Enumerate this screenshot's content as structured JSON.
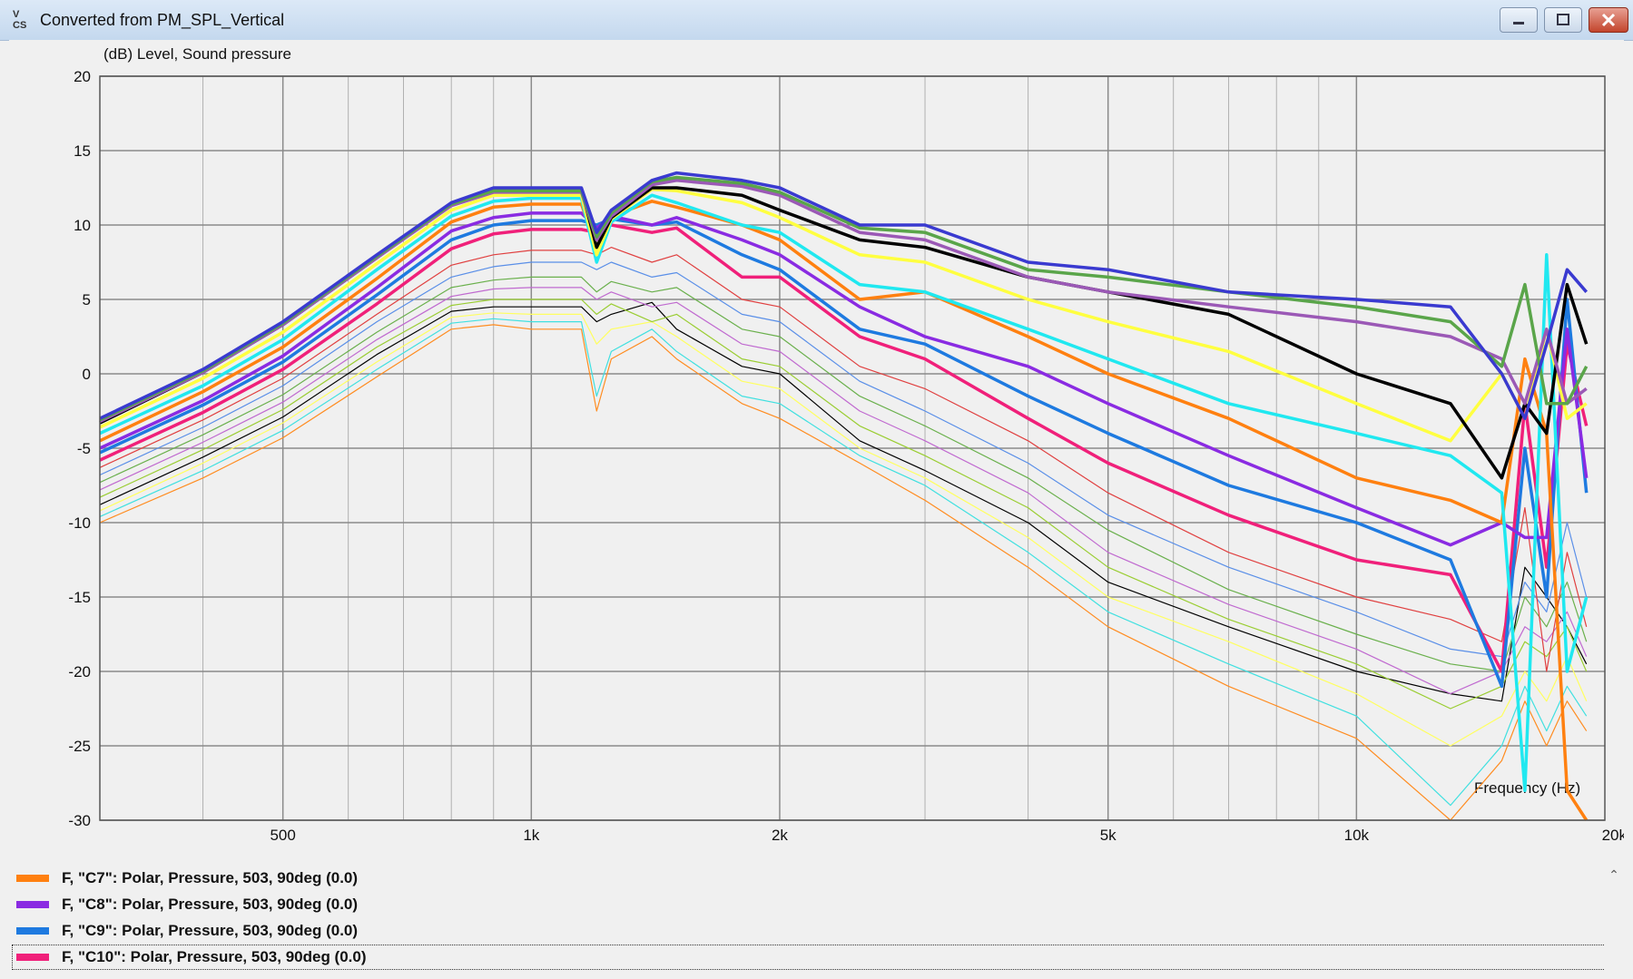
{
  "window": {
    "title": "Converted from PM_SPL_Vertical",
    "icon_name": "app-logo-icon",
    "icon_text": [
      "V",
      "CS"
    ]
  },
  "chart_data": {
    "type": "line",
    "title": "",
    "ylabel": "(dB)  Level, Sound pressure",
    "xlabel": "Frequency  (Hz)",
    "xscale": "log",
    "xlim": [
      300,
      20000
    ],
    "ylim": [
      -30,
      20
    ],
    "grid": true,
    "x_tick_labels": [
      {
        "v": 500,
        "t": "500"
      },
      {
        "v": 1000,
        "t": "1k"
      },
      {
        "v": 2000,
        "t": "2k"
      },
      {
        "v": 5000,
        "t": "5k"
      },
      {
        "v": 10000,
        "t": "10k"
      },
      {
        "v": 20000,
        "t": "20k"
      }
    ],
    "y_ticks": [
      20,
      15,
      10,
      5,
      0,
      -5,
      -10,
      -15,
      -20,
      -25,
      -30
    ],
    "x": [
      300,
      400,
      500,
      650,
      800,
      900,
      1000,
      1150,
      1200,
      1250,
      1400,
      1500,
      1800,
      2000,
      2500,
      3000,
      4000,
      5000,
      7000,
      10000,
      13000,
      15000,
      16000,
      17000,
      18000,
      19000
    ],
    "series": [
      {
        "color": "#3a3ad0",
        "width": 3.5,
        "values": [
          -3.0,
          0.3,
          3.5,
          8.0,
          11.5,
          12.5,
          12.5,
          12.5,
          9.5,
          11.0,
          13.0,
          13.5,
          13.0,
          12.5,
          10.0,
          10.0,
          7.5,
          7.0,
          5.5,
          5.0,
          4.5,
          0.0,
          -3.0,
          2.0,
          7.0,
          5.5
        ]
      },
      {
        "color": "#5aa54a",
        "width": 3.5,
        "values": [
          -3.1,
          0.2,
          3.4,
          7.9,
          11.4,
          12.3,
          12.3,
          12.3,
          9.2,
          10.8,
          12.9,
          13.2,
          12.8,
          12.2,
          9.8,
          9.5,
          7.0,
          6.5,
          5.5,
          4.5,
          3.5,
          0.5,
          6.0,
          -2.0,
          -2.0,
          0.5
        ]
      },
      {
        "color": "#9b59b6",
        "width": 3.5,
        "values": [
          -3.2,
          0.1,
          3.3,
          7.8,
          11.3,
          12.2,
          12.2,
          12.2,
          9.0,
          10.6,
          12.7,
          13.0,
          12.6,
          12.0,
          9.5,
          9.0,
          6.5,
          5.5,
          4.5,
          3.5,
          2.5,
          1.0,
          -2.0,
          3.0,
          -2.0,
          -1.0
        ]
      },
      {
        "color": "#000000",
        "width": 3.5,
        "values": [
          -3.3,
          0.1,
          3.3,
          7.8,
          11.4,
          12.4,
          12.4,
          12.4,
          8.5,
          10.5,
          12.5,
          12.5,
          12.0,
          11.0,
          9.0,
          8.5,
          6.5,
          5.5,
          4.0,
          0.0,
          -2.0,
          -7.0,
          -2.0,
          -4.0,
          6.0,
          2.0
        ]
      },
      {
        "color": "#ffff40",
        "width": 3.5,
        "values": [
          -3.6,
          -0.3,
          2.8,
          7.4,
          11.0,
          12.0,
          12.0,
          12.0,
          8.0,
          10.4,
          12.4,
          12.3,
          11.5,
          10.5,
          8.0,
          7.5,
          5.0,
          3.5,
          1.5,
          -2.0,
          -4.5,
          0.0,
          -3.0,
          3.0,
          -3.0,
          -2.0
        ]
      },
      {
        "color": "#20e8f0",
        "width": 3.5,
        "values": [
          -4.0,
          -0.8,
          2.3,
          7.0,
          10.6,
          11.6,
          11.8,
          11.8,
          7.5,
          10.2,
          12.0,
          11.5,
          10.0,
          9.5,
          6.0,
          5.5,
          3.0,
          1.0,
          -2.0,
          -4.0,
          -5.5,
          -8.0,
          -28.0,
          8.0,
          -20.0,
          -15.0
        ]
      },
      {
        "color": "#ff8010",
        "width": 3.5,
        "values": [
          -4.5,
          -1.2,
          1.8,
          6.4,
          10.2,
          11.2,
          11.4,
          11.4,
          8.5,
          10.6,
          11.6,
          11.2,
          10.0,
          9.0,
          5.0,
          5.5,
          2.5,
          0.0,
          -3.0,
          -7.0,
          -8.5,
          -10.0,
          1.0,
          -4.0,
          -28.0,
          -30.0
        ]
      },
      {
        "color": "#8a2be2",
        "width": 3.5,
        "values": [
          -5.0,
          -1.8,
          1.2,
          5.8,
          9.6,
          10.5,
          10.8,
          10.8,
          9.8,
          10.6,
          10.0,
          10.5,
          9.0,
          8.0,
          4.5,
          2.5,
          0.5,
          -2.0,
          -5.5,
          -9.0,
          -11.5,
          -10.0,
          -11.0,
          -11.0,
          3.0,
          -7.0
        ]
      },
      {
        "color": "#1e7ae0",
        "width": 3.5,
        "values": [
          -5.3,
          -2.1,
          0.8,
          5.3,
          9.0,
          10.0,
          10.3,
          10.3,
          10.0,
          10.4,
          10.0,
          10.2,
          8.0,
          7.0,
          3.0,
          2.0,
          -1.5,
          -4.0,
          -7.5,
          -10.0,
          -12.5,
          -21.0,
          -5.0,
          -15.0,
          5.0,
          -8.0
        ]
      },
      {
        "color": "#f0207a",
        "width": 3.5,
        "values": [
          -5.8,
          -2.6,
          0.3,
          4.7,
          8.4,
          9.4,
          9.7,
          9.7,
          9.5,
          10.0,
          9.5,
          9.8,
          6.5,
          6.5,
          2.5,
          1.0,
          -3.0,
          -6.0,
          -9.5,
          -12.5,
          -13.5,
          -20.0,
          -2.0,
          -13.0,
          2.0,
          -3.5
        ]
      },
      {
        "color": "#e04040",
        "width": 1.2,
        "values": [
          -6.3,
          -3.1,
          -0.3,
          4.0,
          7.3,
          8.0,
          8.3,
          8.3,
          8.0,
          8.5,
          7.5,
          8.0,
          5.0,
          4.5,
          0.5,
          -1.0,
          -4.5,
          -8.0,
          -12.0,
          -15.0,
          -16.5,
          -18.0,
          -9.0,
          -20.0,
          -12.0,
          -17.0
        ]
      },
      {
        "color": "#5a8fe8",
        "width": 1.2,
        "values": [
          -6.8,
          -3.6,
          -0.8,
          3.5,
          6.5,
          7.2,
          7.5,
          7.5,
          7.0,
          7.5,
          6.5,
          6.8,
          4.0,
          3.5,
          -0.5,
          -2.5,
          -6.0,
          -9.5,
          -13.0,
          -16.0,
          -18.5,
          -19.0,
          -14.0,
          -16.0,
          -10.0,
          -15.0
        ]
      },
      {
        "color": "#6ab04c",
        "width": 1.2,
        "values": [
          -7.3,
          -4.1,
          -1.4,
          2.8,
          5.8,
          6.3,
          6.5,
          6.5,
          5.5,
          6.2,
          5.5,
          5.8,
          3.0,
          2.5,
          -1.5,
          -3.5,
          -7.0,
          -10.5,
          -14.5,
          -17.5,
          -19.5,
          -20.0,
          -15.0,
          -17.0,
          -14.0,
          -18.0
        ]
      },
      {
        "color": "#c06ad0",
        "width": 1.2,
        "values": [
          -7.8,
          -4.6,
          -1.9,
          2.3,
          5.2,
          5.7,
          5.8,
          5.8,
          5.0,
          5.5,
          4.5,
          4.8,
          2.0,
          1.5,
          -2.5,
          -4.5,
          -8.0,
          -12.0,
          -15.5,
          -18.5,
          -21.5,
          -20.0,
          -17.0,
          -18.0,
          -16.0,
          -19.0
        ]
      },
      {
        "color": "#9acd32",
        "width": 1.2,
        "values": [
          -8.3,
          -5.1,
          -2.4,
          1.8,
          4.6,
          5.0,
          5.0,
          5.0,
          4.0,
          4.7,
          3.5,
          4.0,
          1.0,
          0.5,
          -3.5,
          -5.5,
          -9.0,
          -13.0,
          -16.5,
          -19.5,
          -22.5,
          -21.0,
          -18.0,
          -19.0,
          -17.0,
          -20.0
        ]
      },
      {
        "color": "#000000",
        "width": 1.2,
        "values": [
          -8.8,
          -5.6,
          -2.9,
          1.3,
          4.2,
          4.5,
          4.5,
          4.5,
          3.5,
          4.0,
          4.8,
          3.0,
          0.5,
          0.0,
          -4.5,
          -6.5,
          -10.0,
          -14.0,
          -17.0,
          -20.0,
          -21.5,
          -22.0,
          -13.0,
          -15.0,
          -17.0,
          -19.5
        ]
      },
      {
        "color": "#ffff60",
        "width": 1.2,
        "values": [
          -9.2,
          -6.0,
          -3.3,
          0.8,
          3.8,
          4.1,
          4.0,
          4.0,
          2.0,
          3.0,
          3.5,
          2.5,
          -0.5,
          -1.0,
          -5.0,
          -7.0,
          -11.0,
          -15.0,
          -18.0,
          -21.5,
          -25.0,
          -23.0,
          -20.0,
          -22.0,
          -19.0,
          -22.0
        ]
      },
      {
        "color": "#40e0e0",
        "width": 1.2,
        "values": [
          -9.6,
          -6.5,
          -3.8,
          0.3,
          3.4,
          3.7,
          3.5,
          3.5,
          -1.5,
          1.5,
          3.0,
          1.5,
          -1.5,
          -2.0,
          -5.5,
          -7.5,
          -12.0,
          -16.0,
          -19.5,
          -23.0,
          -29.0,
          -25.0,
          -21.0,
          -24.0,
          -21.0,
          -23.0
        ]
      },
      {
        "color": "#ff8c20",
        "width": 1.2,
        "values": [
          -10.0,
          -7.0,
          -4.3,
          -0.2,
          3.0,
          3.3,
          3.0,
          3.0,
          -2.5,
          1.0,
          2.5,
          1.0,
          -2.0,
          -3.0,
          -6.0,
          -8.5,
          -13.0,
          -17.0,
          -21.0,
          -24.5,
          -30.0,
          -26.0,
          -22.0,
          -25.0,
          -22.0,
          -24.0
        ]
      }
    ]
  },
  "legend": [
    {
      "color": "#ff8010",
      "label": "F, \"C7\": Polar, Pressure, 503, 90deg (0.0)"
    },
    {
      "color": "#8a2be2",
      "label": "F, \"C8\": Polar, Pressure, 503, 90deg (0.0)"
    },
    {
      "color": "#1e7ae0",
      "label": "F, \"C9\": Polar, Pressure, 503, 90deg (0.0)"
    },
    {
      "color": "#f0207a",
      "label": "F, \"C10\": Polar, Pressure, 503, 90deg (0.0)"
    }
  ]
}
